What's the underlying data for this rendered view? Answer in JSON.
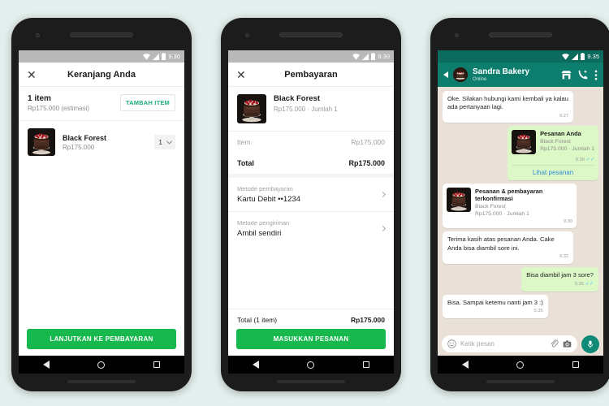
{
  "background_color": "#e3efed",
  "accent_green": "#17b84e",
  "accent_teal": "#1fae7c",
  "whatsapp_teal": "#0d7e6e",
  "phone1": {
    "status_bar": {
      "time": "9.30",
      "icons": [
        "wifi-icon",
        "signal-icon",
        "battery-icon"
      ]
    },
    "appbar": {
      "close_label": "✕",
      "title": "Keranjang Anda"
    },
    "summary": {
      "count": "1 item",
      "estimate": "Rp175.000 (estimasi)",
      "add_item_label": "TAMBAH ITEM"
    },
    "item": {
      "name": "Black Forest",
      "price": "Rp175.000",
      "qty": "1"
    },
    "cta_label": "LANJUTKAN KE PEMBAYARAN"
  },
  "phone2": {
    "status_bar": {
      "time": "9.30"
    },
    "appbar": {
      "close_label": "✕",
      "title": "Pembayaran"
    },
    "item": {
      "name": "Black Forest",
      "detail": "Rp175.000 · Jumlah 1"
    },
    "rows": [
      {
        "label": "Item",
        "value": "Rp175.000",
        "emphasis": false
      },
      {
        "label": "Total",
        "value": "Rp175.000",
        "emphasis": true
      }
    ],
    "methods": [
      {
        "label": "Metode pembayaran",
        "value": "Kartu Debit ••1234"
      },
      {
        "label": "Metode pengiriman",
        "value": "Ambil sendiri"
      }
    ],
    "footer": {
      "total_label": "Total (1 item)",
      "total_value": "Rp175.000"
    },
    "cta_label": "MASUKKAN PESANAN"
  },
  "phone3": {
    "status_bar": {
      "time": "9.35"
    },
    "header": {
      "contact": "Sandra Bakery",
      "presence": "Online",
      "icons": [
        "store-icon",
        "video-call-icon",
        "overflow-menu-icon"
      ]
    },
    "messages": [
      {
        "kind": "text",
        "side": "in",
        "text": "Oke. Silakan hubungi kami kembali ya kalau ada pertanyaan lagi.",
        "time": "9.27"
      },
      {
        "kind": "card",
        "side": "out",
        "title": "Pesanan Anda",
        "line1": "Black Forest",
        "line2": "Rp175.000 · Jumlah 1",
        "time": "9.30",
        "ticks": "✓✓",
        "action": "Lihat pesanan"
      },
      {
        "kind": "card",
        "side": "in",
        "title": "Pesanan & pembayaran terkonfirmasi",
        "line1": "Black Forest",
        "line2": "Rp175.000 · Jumlah 1",
        "time": "9.30",
        "action": ""
      },
      {
        "kind": "text",
        "side": "in",
        "text": "Terima kasih atas pesanan Anda. Cake Anda bisa diambil sore ini.",
        "time": "9.32"
      },
      {
        "kind": "text",
        "side": "out",
        "text": "Bisa diambil jam 3 sore?",
        "time": "9.35",
        "ticks": "✓✓"
      },
      {
        "kind": "text",
        "side": "in",
        "text": "Bisa. Sampai ketemu nanti jam 3 :)",
        "time": "9.35"
      }
    ],
    "input": {
      "placeholder": "Ketik pesan",
      "icons": [
        "emoji-icon",
        "attach-icon",
        "camera-icon",
        "mic-icon"
      ]
    }
  }
}
